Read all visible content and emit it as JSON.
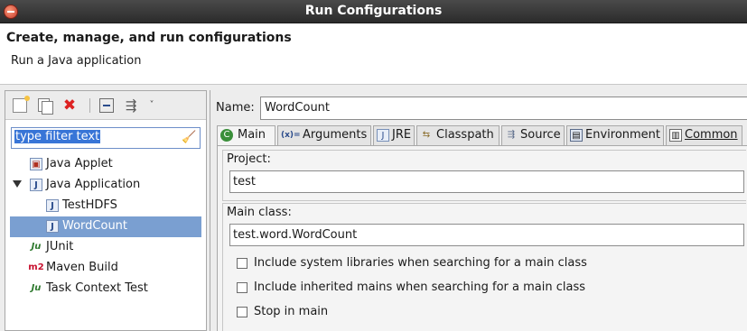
{
  "window": {
    "title": "Run Configurations"
  },
  "header": {
    "title": "Create, manage, and run configurations",
    "subtitle": "Run a Java application"
  },
  "left": {
    "toolbar": [
      {
        "icon": "new-config-icon"
      },
      {
        "icon": "duplicate-icon"
      },
      {
        "icon": "delete-icon",
        "glyph": "✖"
      },
      {
        "icon": "collapse-all-icon"
      },
      {
        "icon": "filter-icon",
        "glyph": "⇶"
      },
      {
        "icon": "chevron-down-icon",
        "glyph": "˅"
      }
    ],
    "filter": {
      "value": "type filter text"
    },
    "tree": [
      {
        "label": "Java Applet",
        "icon": "java-applet-icon",
        "glyph": "▣"
      },
      {
        "label": "Java Application",
        "icon": "java-application-icon",
        "glyph": "J",
        "expanded": true
      },
      {
        "label": "TestHDFS",
        "icon": "java-class-icon",
        "glyph": "J"
      },
      {
        "label": "WordCount",
        "icon": "java-class-icon",
        "glyph": "J",
        "selected": true
      },
      {
        "label": "JUnit",
        "icon": "junit-icon",
        "glyph": "Ju"
      },
      {
        "label": "Maven Build",
        "icon": "maven-icon",
        "glyph": "m2"
      },
      {
        "label": "Task Context Test",
        "icon": "task-context-icon",
        "glyph": "Ju"
      }
    ]
  },
  "right": {
    "name_label": "Name:",
    "name_value": "WordCount",
    "tabs": [
      {
        "label": "Main",
        "glyph": "C",
        "active": true
      },
      {
        "label": "Arguments",
        "glyph": "(x)="
      },
      {
        "label": "JRE",
        "glyph": "J"
      },
      {
        "label": "Classpath",
        "glyph": "⇆"
      },
      {
        "label": "Source",
        "glyph": "⇶"
      },
      {
        "label": "Environment",
        "glyph": "▤"
      },
      {
        "label": "Common",
        "glyph": "▥"
      }
    ],
    "project": {
      "label": "Project:",
      "value": "test"
    },
    "main_class": {
      "label": "Main class:",
      "value": "test.word.WordCount"
    },
    "checkboxes": [
      {
        "label": "Include system libraries when searching for a main class",
        "checked": false
      },
      {
        "label": "Include inherited mains when searching for a main class",
        "checked": false
      },
      {
        "label": "Stop in main",
        "checked": false
      }
    ]
  },
  "colors": {
    "selection": "#7a9fd1",
    "title_bar": "#2b2b2b",
    "filter_highlight": "#3875d7"
  }
}
